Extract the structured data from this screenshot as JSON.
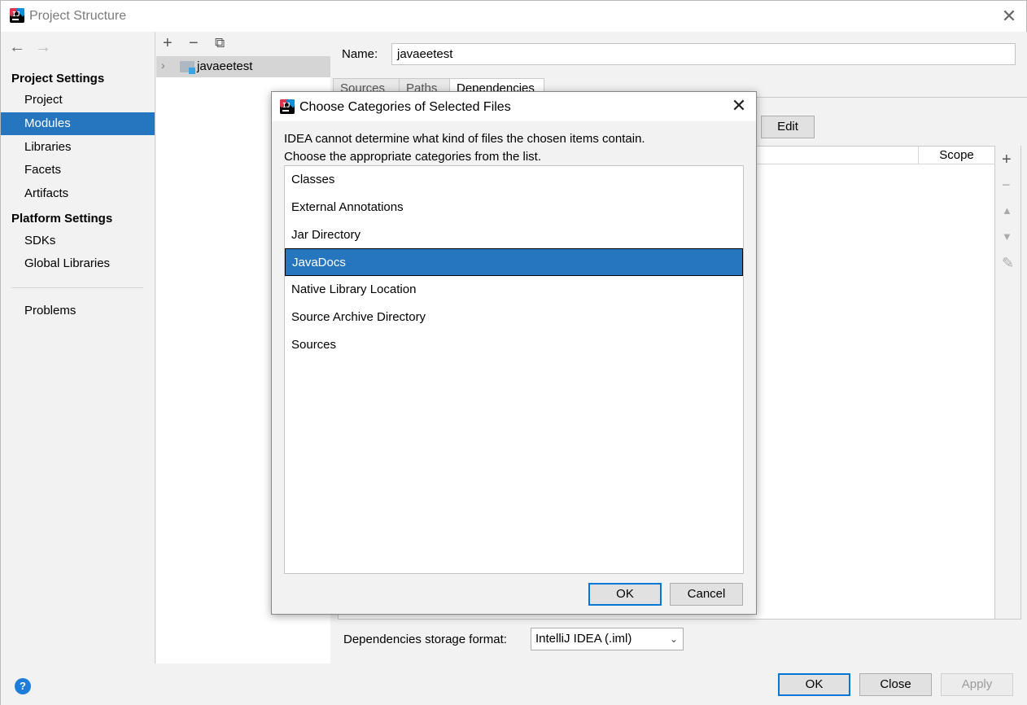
{
  "window": {
    "title": "Project Structure"
  },
  "nav": {
    "sections": [
      {
        "label": "Project Settings"
      },
      {
        "label": "Platform Settings"
      }
    ],
    "items": [
      {
        "label": "Project"
      },
      {
        "label": "Modules",
        "selected": true
      },
      {
        "label": "Libraries"
      },
      {
        "label": "Facets"
      },
      {
        "label": "Artifacts"
      },
      {
        "label": "SDKs"
      },
      {
        "label": "Global Libraries"
      },
      {
        "label": "Problems"
      }
    ]
  },
  "tree": {
    "module_name": "javaeetest"
  },
  "detail": {
    "name_label": "Name:",
    "name_value": "javaeetest",
    "tabs": [
      "Sources",
      "Paths",
      "Dependencies"
    ],
    "selected_tab": "Dependencies",
    "edit_label": "Edit",
    "scope_header": "Scope",
    "storage_label": "Dependencies storage format:",
    "storage_value": "IntelliJ IDEA (.iml)"
  },
  "footer": {
    "ok": "OK",
    "close": "Close",
    "apply": "Apply",
    "help": "?"
  },
  "dialog": {
    "title": "Choose Categories of Selected Files",
    "message_line1": "IDEA cannot determine what kind of files the chosen items contain.",
    "message_line2": "Choose the appropriate categories from the list.",
    "categories": [
      {
        "label": "Classes"
      },
      {
        "label": "External Annotations"
      },
      {
        "label": "Jar Directory"
      },
      {
        "label": "JavaDocs",
        "selected": true
      },
      {
        "label": "Native Library Location"
      },
      {
        "label": "Source Archive Directory"
      },
      {
        "label": "Sources"
      }
    ],
    "ok": "OK",
    "cancel": "Cancel"
  },
  "colors": {
    "selection": "#2675bf",
    "default_button_border": "#0078d7"
  }
}
